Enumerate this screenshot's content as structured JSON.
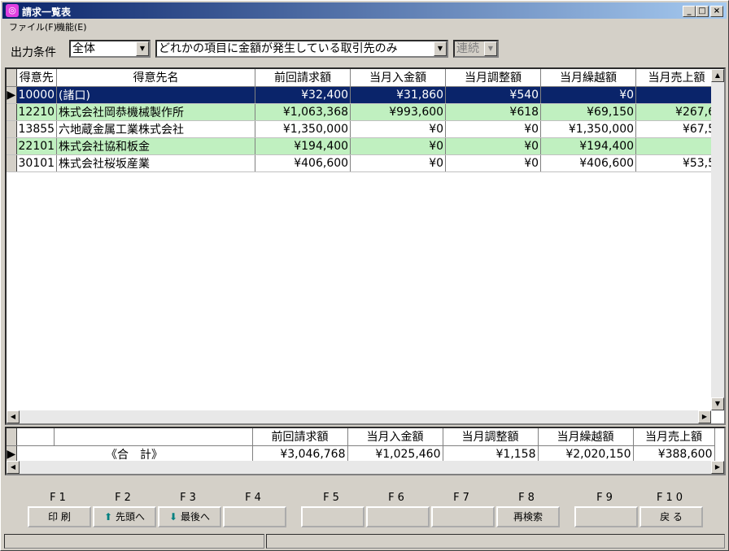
{
  "window": {
    "title": "請求一覧表",
    "icon": "app-icon"
  },
  "menu": [
    "ファイル(F)",
    "機能(E)"
  ],
  "condition": {
    "label": "出力条件",
    "scope": "全体",
    "filter": "どれかの項目に金額が発生している取引先のみ",
    "mode": "連続"
  },
  "columns": [
    "得意先",
    "得意先名",
    "前回請求額",
    "当月入金額",
    "当月調整額",
    "当月繰越額",
    "当月売上額"
  ],
  "rows": [
    {
      "code": "10000",
      "name": "(諸口)",
      "prev": "¥32,400",
      "paid": "¥31,860",
      "adj": "¥540",
      "carry": "¥0",
      "sales": ""
    },
    {
      "code": "12210",
      "name": "株式会社岡恭機械製作所",
      "prev": "¥1,063,368",
      "paid": "¥993,600",
      "adj": "¥618",
      "carry": "¥69,150",
      "sales": "¥267,6"
    },
    {
      "code": "13855",
      "name": "六地蔵金属工業株式会社",
      "prev": "¥1,350,000",
      "paid": "¥0",
      "adj": "¥0",
      "carry": "¥1,350,000",
      "sales": "¥67,5"
    },
    {
      "code": "22101",
      "name": "株式会社協和板金",
      "prev": "¥194,400",
      "paid": "¥0",
      "adj": "¥0",
      "carry": "¥194,400",
      "sales": ""
    },
    {
      "code": "30101",
      "name": "株式会社桜坂産業",
      "prev": "¥406,600",
      "paid": "¥0",
      "adj": "¥0",
      "carry": "¥406,600",
      "sales": "¥53,5"
    }
  ],
  "totals": {
    "label": "《合　計》",
    "prev": "¥3,046,768",
    "paid": "¥1,025,460",
    "adj": "¥1,158",
    "carry": "¥2,020,150",
    "sales": "¥388,600"
  },
  "fkeys": [
    {
      "key": "F1",
      "label": "印 刷"
    },
    {
      "key": "F2",
      "label": "先頭へ"
    },
    {
      "key": "F3",
      "label": "最後へ"
    },
    {
      "key": "F4",
      "label": ""
    },
    {
      "key": "F5",
      "label": ""
    },
    {
      "key": "F6",
      "label": ""
    },
    {
      "key": "F7",
      "label": ""
    },
    {
      "key": "F8",
      "label": "再検索"
    },
    {
      "key": "F9",
      "label": ""
    },
    {
      "key": "F10",
      "label": "戻 る"
    }
  ],
  "colors": {
    "title_start": "#0a246a",
    "selected_row": "#0a246a",
    "alt_row": "#c0f0c0"
  }
}
